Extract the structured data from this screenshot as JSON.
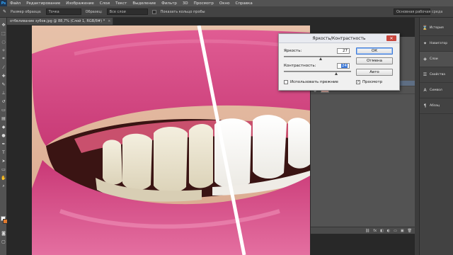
{
  "app": {
    "logo": "Ps",
    "menu": [
      "Файл",
      "Редактирование",
      "Изображение",
      "Слои",
      "Текст",
      "Выделение",
      "Фильтр",
      "3D",
      "Просмотр",
      "Окно",
      "Справка"
    ]
  },
  "options_bar": {
    "sample_size_label": "Размер образца:",
    "sample_size_value": "Точка",
    "sample_label": "Образец:",
    "sample_value": "Все слои",
    "show_ring_label": "Показать кольцо пробы",
    "workspace": "Основная рабочая среда"
  },
  "document_tab": {
    "title": "отбеливание зубов.jpg @ 88,7% (Слой 1, RGB/8#) *",
    "close": "×"
  },
  "dialog": {
    "title": "Яркость/Контрастность",
    "close": "✕",
    "brightness_label": "Яркость:",
    "brightness_value": "27",
    "contrast_label": "Контрастность:",
    "contrast_value": "24",
    "use_legacy_label": "Использовать прежние",
    "use_legacy_checked": false,
    "ok_label": "ОК",
    "cancel_label": "Отмена",
    "auto_label": "Авто",
    "preview_label": "Просмотр",
    "preview_checked": true
  },
  "layers": [
    {
      "name": "Фон",
      "active": false
    }
  ],
  "dock": [
    {
      "icon": "history-icon",
      "label": "История",
      "active": false
    },
    {
      "icon": "navigator-icon",
      "label": "Навигатор",
      "active": false
    },
    {
      "icon": "layers-icon",
      "label": "Слои",
      "active": true
    },
    {
      "icon": "properties-icon",
      "label": "Свойства",
      "active": false
    },
    {
      "icon": "symbols-icon",
      "label": "Символ",
      "active": false
    },
    {
      "icon": "paragraph-icon",
      "label": "Абзац",
      "active": false
    }
  ],
  "colors": {
    "foreground": "#ffffff",
    "background": "#e07a2e",
    "lip": "#d2467f",
    "dialog_accent": "#3b78d8"
  }
}
